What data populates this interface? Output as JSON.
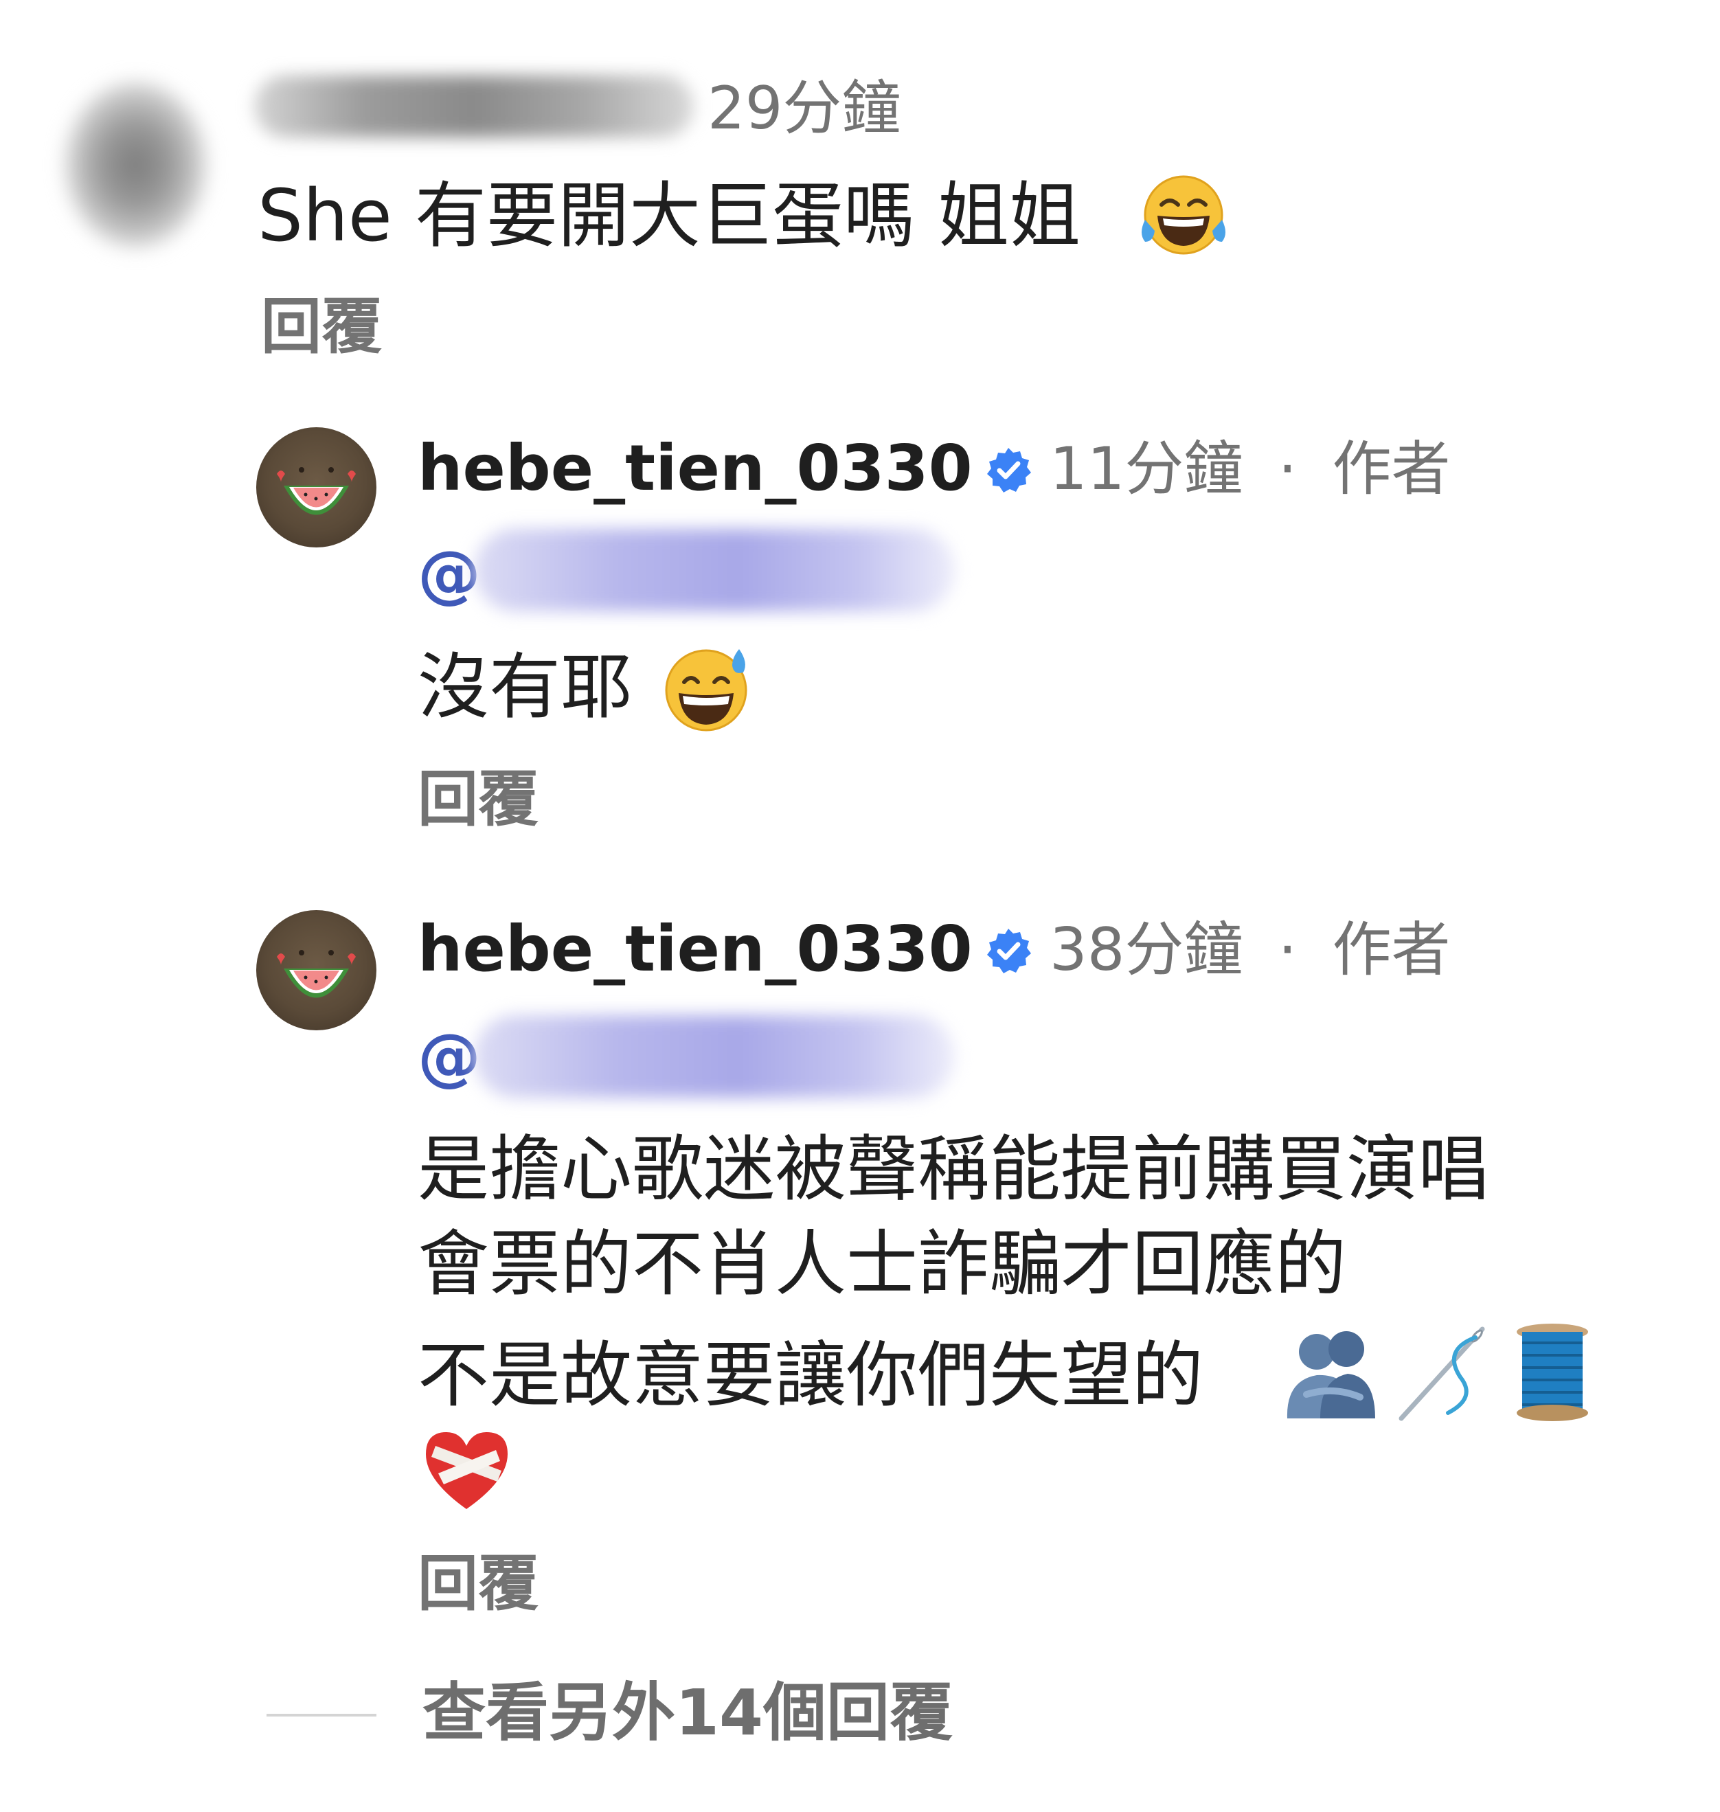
{
  "comments": [
    {
      "username_redacted": true,
      "timestamp": "29分鐘",
      "text": "She 有要開大巨蛋嗎 姐姐",
      "emoji": "face-with-tears-of-joy",
      "reply_label": "回覆"
    }
  ],
  "replies": [
    {
      "username": "hebe_tien_0330",
      "verified": true,
      "timestamp": "11分鐘",
      "separator": "·",
      "author_label": "作者",
      "mention_prefix": "@",
      "lines": [
        "沒有耶"
      ],
      "emojis": [
        "grinning-face-with-sweat"
      ],
      "reply_label": "回覆"
    },
    {
      "username": "hebe_tien_0330",
      "verified": true,
      "timestamp": "38分鐘",
      "separator": "·",
      "author_label": "作者",
      "mention_prefix": "@",
      "lines": [
        "是擔心歌迷被聲稱能提前購買演唱",
        "會票的不肖人士詐騙才回應的",
        "不是故意要讓你們失望的"
      ],
      "emojis": [
        "people-hugging",
        "sewing-needle",
        "spool-of-thread",
        "mending-heart"
      ],
      "reply_label": "回覆"
    }
  ],
  "view_more": "查看另外14個回覆",
  "colors": {
    "meta_gray": "#737373",
    "text": "#1f1f1f",
    "mention_blue": "#3f59b8",
    "verified_blue": "#3b82f6"
  }
}
